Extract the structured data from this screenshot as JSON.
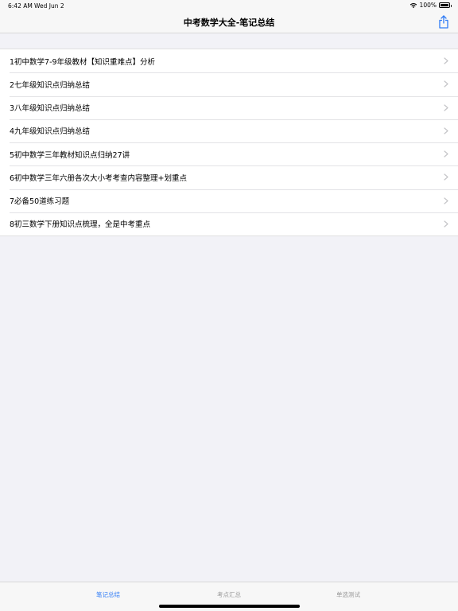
{
  "status_bar": {
    "time": "6:42 AM",
    "date": "Wed Jun 2",
    "battery_text": "100%"
  },
  "nav": {
    "title": "中考数学大全-笔记总结",
    "share_icon": "share-icon"
  },
  "list": {
    "items": [
      {
        "label": "1初中数学7-9年级教材【知识重难点】分析"
      },
      {
        "label": "2七年级知识点归纳总结"
      },
      {
        "label": "3八年级知识点归纳总结"
      },
      {
        "label": "4九年级知识点归纳总结"
      },
      {
        "label": "5初中数学三年教材知识点归纳27讲"
      },
      {
        "label": "6初中数学三年六册各次大小考考查内容整理+划重点"
      },
      {
        "label": "7必备50道练习题"
      },
      {
        "label": "8初三数学下册知识点梳理，全是中考重点"
      }
    ]
  },
  "tab_bar": {
    "tabs": [
      {
        "label": "笔记总结",
        "active": true
      },
      {
        "label": "考点汇总",
        "active": false
      },
      {
        "label": "单选测试",
        "active": false
      }
    ]
  },
  "colors": {
    "accent": "#2f7bf5",
    "inactive_tab": "#999999",
    "background": "#f2f2f7"
  }
}
